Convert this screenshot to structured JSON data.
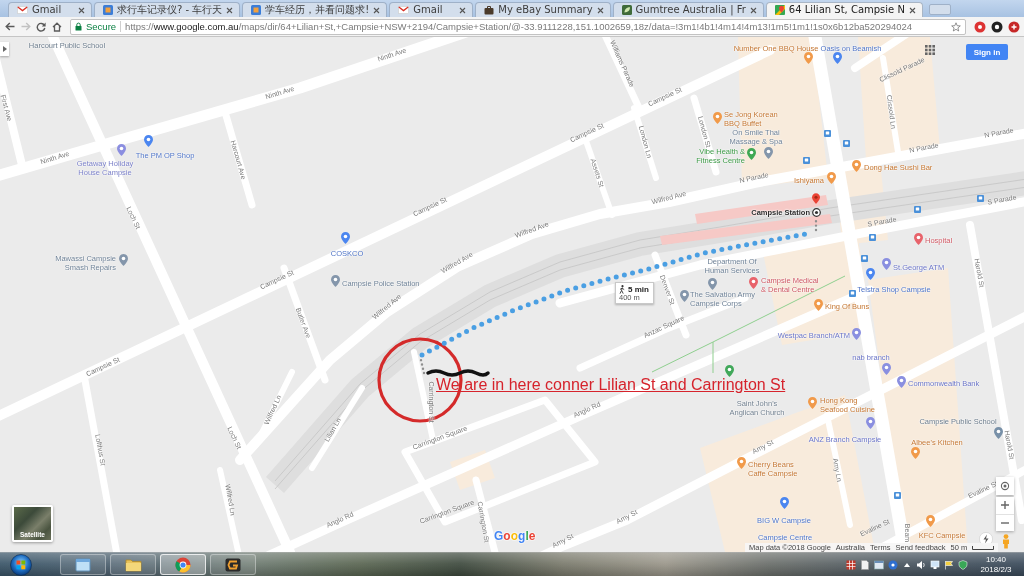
{
  "browser": {
    "tabs": [
      {
        "title": "Gmail",
        "selected": false
      },
      {
        "title": "求行车记录仪? - 车行天",
        "selected": false
      },
      {
        "title": "学车经历，并看问题求!",
        "selected": false
      },
      {
        "title": "Gmail",
        "selected": false
      },
      {
        "title": "My eBay Summary",
        "selected": false
      },
      {
        "title": "Gumtree Australia | Fr",
        "selected": false
      },
      {
        "title": "64 Lilian St, Campsie N",
        "selected": true
      }
    ],
    "nav_buttons": [
      {
        "kind": "back",
        "disabled": false
      },
      {
        "kind": "forward",
        "disabled": true
      },
      {
        "kind": "reload",
        "disabled": false
      },
      {
        "kind": "home",
        "disabled": false
      }
    ],
    "address_bar": {
      "security": "Secure",
      "url": "https://**www.google.com.au**/maps/dir/64+Lilian+St,+Campsie+NSW+2194/Campsie+Station/@-33.9111228,151.1002659,18z/data=!3m1!4b1!4m14!4m13!1m5!1m1!1s0x6b12ba520294024"
    }
  },
  "map": {
    "sign_in": "Sign in",
    "streets": [
      {
        "name": "First Ave"
      },
      {
        "name": "Ninth Ave"
      },
      {
        "name": "Ninth Ave"
      },
      {
        "name": "Ninth Ave"
      },
      {
        "name": "Harcourt Ave"
      },
      {
        "name": "Loch St"
      },
      {
        "name": "Loch St"
      },
      {
        "name": "Campsie St"
      },
      {
        "name": "Campsie St"
      },
      {
        "name": "Campsie St"
      },
      {
        "name": "Campsie St"
      },
      {
        "name": "Campsie St"
      },
      {
        "name": "Williams Parade"
      },
      {
        "name": "Wilfred Ave"
      },
      {
        "name": "Wilfred Ave"
      },
      {
        "name": "Wilfred Ave"
      },
      {
        "name": "Wilfred Ave"
      },
      {
        "name": "Butler Ave"
      },
      {
        "name": "London Ln"
      },
      {
        "name": "London St"
      },
      {
        "name": "Assets St"
      },
      {
        "name": "N Parade"
      },
      {
        "name": "N Parade"
      },
      {
        "name": "N Parade"
      },
      {
        "name": "Clissold Parade"
      },
      {
        "name": "Clissold Ln"
      },
      {
        "name": "S Parade"
      },
      {
        "name": "S Parade"
      },
      {
        "name": "Denver St"
      },
      {
        "name": "Anzac Square"
      },
      {
        "name": "Harold St"
      },
      {
        "name": "Harold St"
      },
      {
        "name": "Wilfred Ln"
      },
      {
        "name": "Wilfred Ln"
      },
      {
        "name": "Lilian Ln"
      },
      {
        "name": "Carrington St"
      },
      {
        "name": "Carrington St"
      },
      {
        "name": "Carrington Square"
      },
      {
        "name": "Carrington Square"
      },
      {
        "name": "Anglo Rd"
      },
      {
        "name": "Anglo Rd"
      },
      {
        "name": "Amy St"
      },
      {
        "name": "Amy St"
      },
      {
        "name": "Amy St"
      },
      {
        "name": "Amy Ln"
      },
      {
        "name": "Lofthus St"
      },
      {
        "name": "Evaline St"
      },
      {
        "name": "Evaline St"
      },
      {
        "name": "Beam"
      }
    ],
    "places": [
      {
        "name": "Harcourt Public School",
        "kind": "school"
      },
      {
        "name": "The PM OP Shop",
        "kind": "shop"
      },
      {
        "name": "Getaway Holiday House Campsie",
        "kind": "lodging"
      },
      {
        "name": "COSKCO",
        "kind": "shop"
      },
      {
        "name": "Mawassi Campsie Smash Repairs",
        "kind": "service"
      },
      {
        "name": "Campsie Police Station",
        "kind": "service"
      },
      {
        "name": "Number One BBQ House",
        "kind": "food"
      },
      {
        "name": "Oasis on Beamish",
        "kind": "shop"
      },
      {
        "name": "Se Jong Korean BBQ Buffet",
        "kind": "food"
      },
      {
        "name": "On Smile Thai Massage & Spa",
        "kind": "service"
      },
      {
        "name": "Vibe Health & Fitness Centre",
        "kind": "fitness"
      },
      {
        "name": "Dong Hae Sushi Bar",
        "kind": "food"
      },
      {
        "name": "Ishiyama",
        "kind": "food"
      },
      {
        "name": "Campsie Station",
        "kind": "station"
      },
      {
        "name": "Department Of Human Services",
        "kind": "service"
      },
      {
        "name": "Campsie Medical & Dental Centre",
        "kind": "health"
      },
      {
        "name": "The Salvation Army Campsie Corps",
        "kind": "service"
      },
      {
        "name": "Hospital",
        "kind": "health"
      },
      {
        "name": "St.George ATM",
        "kind": "bank"
      },
      {
        "name": "Telstra Shop Campsie",
        "kind": "shop"
      },
      {
        "name": "King Of Buns",
        "kind": "food"
      },
      {
        "name": "Westpac Branch/ATM",
        "kind": "bank"
      },
      {
        "name": "nab branch",
        "kind": "bank"
      },
      {
        "name": "Commonwealth Bank",
        "kind": "bank"
      },
      {
        "name": "Saint John's Anglican Church",
        "kind": "church"
      },
      {
        "name": "Hong Kong Seafood Cuisine",
        "kind": "food"
      },
      {
        "name": "ANZ Branch Campsie",
        "kind": "bank"
      },
      {
        "name": "Campsie Public School",
        "kind": "school"
      },
      {
        "name": "Albee's Kitchen",
        "kind": "food"
      },
      {
        "name": "Cherry Beans Caffe Campsie",
        "kind": "food"
      },
      {
        "name": "BIG W Campsie",
        "kind": "shop"
      },
      {
        "name": "Campsie Centre",
        "kind": "shop"
      },
      {
        "name": "KFC Campsie",
        "kind": "food"
      }
    ],
    "route": {
      "duration": "5 min",
      "distance": "400 m"
    },
    "note": "We are in here conner Lilian St and Carrington St",
    "satellite": "Satellite",
    "logo": "Google",
    "footer": {
      "map_data": "Map data ©2018 Google",
      "region": "Australia",
      "terms": "Terms",
      "feedback": "Send feedback",
      "scale": "50 m"
    }
  },
  "taskbar": {
    "apps": [
      {
        "selected": false
      },
      {
        "selected": false
      },
      {
        "selected": true
      },
      {
        "selected": false
      }
    ],
    "time": "10:40",
    "date": "2018/2/3"
  }
}
